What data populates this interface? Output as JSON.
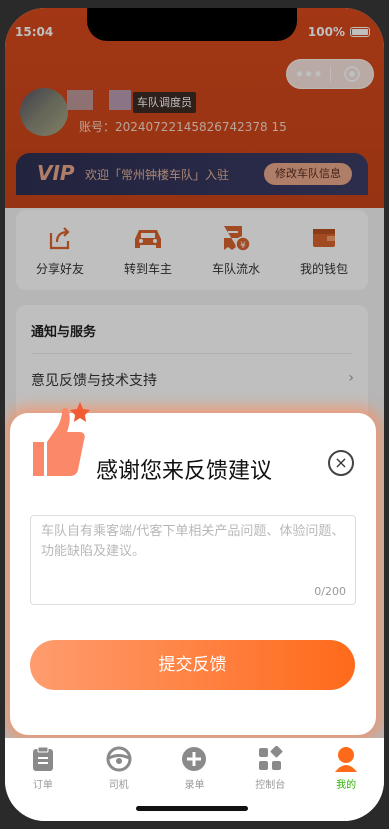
{
  "status": {
    "time": "15:04",
    "battery": "100%"
  },
  "capsule": {
    "more": "•••",
    "icons": [
      "more-icon",
      "target-icon"
    ]
  },
  "profile": {
    "role": "车队调度员",
    "account": "账号：20240722145826742378 15"
  },
  "vip": {
    "badge": "VIP",
    "welcome": "欢迎「常州钟楼车队」入驻",
    "edit": "修改车队信息"
  },
  "quick_actions": [
    {
      "label": "分享好友",
      "icon": "share-icon"
    },
    {
      "label": "转到车主",
      "icon": "car-icon"
    },
    {
      "label": "车队流水",
      "icon": "ledger-icon"
    },
    {
      "label": "我的钱包",
      "icon": "wallet-icon"
    }
  ],
  "services": {
    "title": "通知与服务",
    "row": "意见反馈与技术支持",
    "chevron": "›"
  },
  "modal": {
    "title": "感谢您来反馈建议",
    "placeholder": "车队自有乘客端/代客下单相关产品问题、体验问题、功能缺陷及建议。",
    "counter": "0/200",
    "submit": "提交反馈",
    "close": "×"
  },
  "tabbar": [
    {
      "label": "订单",
      "icon": "order-icon"
    },
    {
      "label": "司机",
      "icon": "steering-wheel-icon"
    },
    {
      "label": "录单",
      "icon": "plus-icon"
    },
    {
      "label": "控制台",
      "icon": "dashboard-icon"
    },
    {
      "label": "我的",
      "icon": "user-icon",
      "active": true
    }
  ],
  "colors": {
    "accent": "#ff6a1a",
    "header": "#d8491c",
    "active_tab": "#2db300"
  }
}
